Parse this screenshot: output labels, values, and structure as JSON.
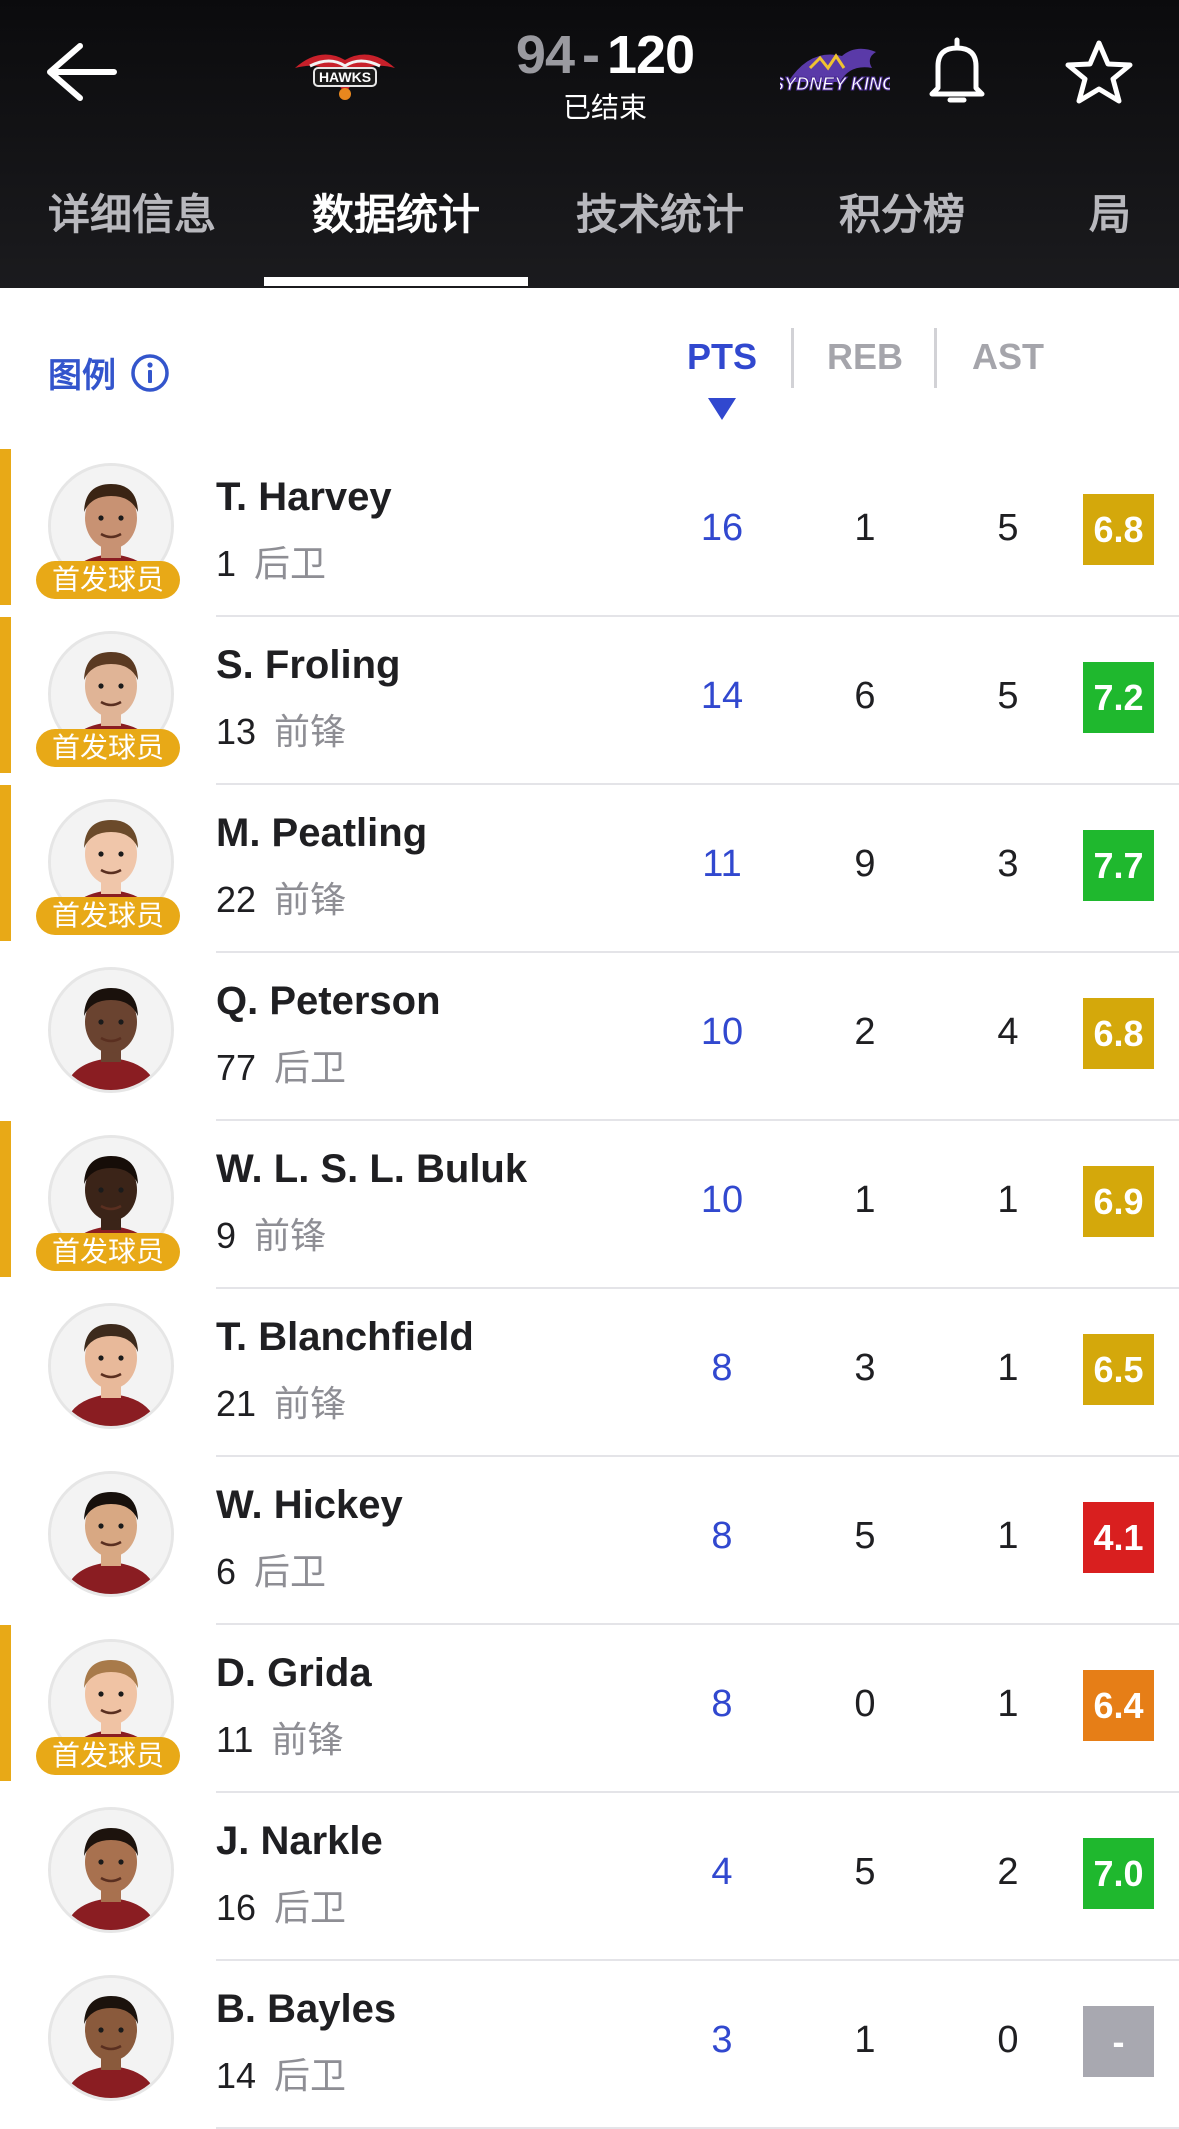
{
  "header": {
    "home_team_logo": "HAWKS",
    "away_team_logo": "SYDNEY KINGS",
    "home_score": "94",
    "separator": "-",
    "away_score": "120",
    "status": "已结束",
    "icons": {
      "back": "back-arrow-icon",
      "bell": "bell-icon",
      "star": "star-icon"
    }
  },
  "tabs": [
    {
      "label": "详细信息"
    },
    {
      "label": "数据统计"
    },
    {
      "label": "技术统计"
    },
    {
      "label": "积分榜"
    },
    {
      "label": "局"
    }
  ],
  "active_tab": "数据统计",
  "legend": {
    "label": "图例"
  },
  "columns": {
    "pts": "PTS",
    "reb": "REB",
    "ast": "AST"
  },
  "sorted_column": "PTS",
  "starter_label": "首发球员",
  "colors": {
    "accent_blue": "#3148cf",
    "starter_gold": "#e8a917",
    "rating_yellow": "#d4a80b",
    "rating_green": "#1fb82e",
    "rating_red": "#d91f1f",
    "rating_orange": "#e67e17",
    "rating_gray": "#a8a8b0"
  },
  "players": [
    {
      "name": "T. Harvey",
      "number": "1",
      "position": "后卫",
      "pts": "16",
      "reb": "1",
      "ast": "5",
      "rating": "6.8",
      "rating_color": "#d4a80b",
      "starter": true,
      "skin": "#c89273",
      "hair": "#3a2414"
    },
    {
      "name": "S. Froling",
      "number": "13",
      "position": "前锋",
      "pts": "14",
      "reb": "6",
      "ast": "5",
      "rating": "7.2",
      "rating_color": "#1fb82e",
      "starter": true,
      "skin": "#e0b496",
      "hair": "#5b3a22"
    },
    {
      "name": "M. Peatling",
      "number": "22",
      "position": "前锋",
      "pts": "11",
      "reb": "9",
      "ast": "3",
      "rating": "7.7",
      "rating_color": "#1fb82e",
      "starter": true,
      "skin": "#f0c6aa",
      "hair": "#6b4a2a"
    },
    {
      "name": "Q. Peterson",
      "number": "77",
      "position": "后卫",
      "pts": "10",
      "reb": "2",
      "ast": "4",
      "rating": "6.8",
      "rating_color": "#d4a80b",
      "starter": false,
      "skin": "#6a4330",
      "hair": "#1a110c"
    },
    {
      "name": "W. L. S. L. Buluk",
      "number": "9",
      "position": "前锋",
      "pts": "10",
      "reb": "1",
      "ast": "1",
      "rating": "6.9",
      "rating_color": "#d4a80b",
      "starter": true,
      "skin": "#3b2418",
      "hair": "#160d08"
    },
    {
      "name": "T. Blanchfield",
      "number": "21",
      "position": "前锋",
      "pts": "8",
      "reb": "3",
      "ast": "1",
      "rating": "6.5",
      "rating_color": "#d4a80b",
      "starter": false,
      "skin": "#e8b99a",
      "hair": "#3d2a1c"
    },
    {
      "name": "W. Hickey",
      "number": "6",
      "position": "后卫",
      "pts": "8",
      "reb": "5",
      "ast": "1",
      "rating": "4.1",
      "rating_color": "#d91f1f",
      "starter": false,
      "skin": "#d8a883",
      "hair": "#17100c"
    },
    {
      "name": "D. Grida",
      "number": "11",
      "position": "前锋",
      "pts": "8",
      "reb": "0",
      "ast": "1",
      "rating": "6.4",
      "rating_color": "#e67e17",
      "starter": true,
      "skin": "#f0c3a4",
      "hair": "#a87a4a"
    },
    {
      "name": "J. Narkle",
      "number": "16",
      "position": "后卫",
      "pts": "4",
      "reb": "5",
      "ast": "2",
      "rating": "7.0",
      "rating_color": "#1fb82e",
      "starter": false,
      "skin": "#a8714f",
      "hair": "#1d130d"
    },
    {
      "name": "B. Bayles",
      "number": "14",
      "position": "后卫",
      "pts": "3",
      "reb": "1",
      "ast": "0",
      "rating": "-",
      "rating_color": "#a8a8b0",
      "starter": false,
      "skin": "#8a5a3c",
      "hair": "#1b120c"
    }
  ]
}
